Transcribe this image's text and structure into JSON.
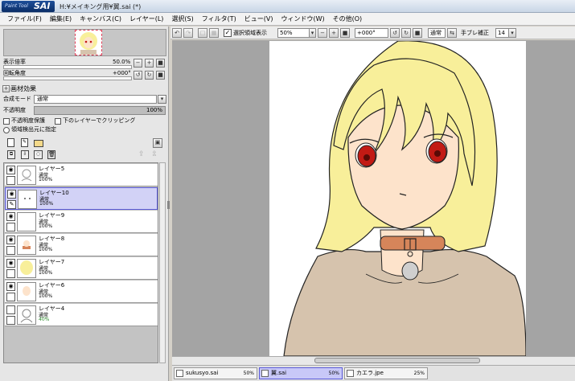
{
  "app": {
    "logo_small": "Paint Tool",
    "logo_big": "SAI",
    "window_title": "H:¥メイキング用¥翼.sai (*)"
  },
  "menus": [
    "ファイル(F)",
    "編集(E)",
    "キャンバス(C)",
    "レイヤー(L)",
    "選択(S)",
    "フィルタ(T)",
    "ビュー(V)",
    "ウィンドウ(W)",
    "その他(O)"
  ],
  "navigator": {
    "zoom_label": "表示倍率",
    "zoom_value": "50.0%",
    "rotate_label": "回転角度",
    "rotate_value": "+000°"
  },
  "layer_panel": {
    "effects_header": "画材効果",
    "blend_label": "合成モード",
    "blend_value": "通常",
    "opacity_label": "不透明度",
    "opacity_value": "100%",
    "preserve_opacity": "不透明度保護",
    "clipping": "下のレイヤーでクリッピング",
    "selection_source": "領域検出元に指定"
  },
  "layers": [
    {
      "name": "レイヤー5",
      "mode": "通常",
      "opacity": "100%",
      "visible": true,
      "selected": false
    },
    {
      "name": "レイヤー10",
      "mode": "通常",
      "opacity": "100%",
      "visible": true,
      "selected": true
    },
    {
      "name": "レイヤー9",
      "mode": "通常",
      "opacity": "100%",
      "visible": true,
      "selected": false
    },
    {
      "name": "レイヤー8",
      "mode": "通常",
      "opacity": "100%",
      "visible": true,
      "selected": false
    },
    {
      "name": "レイヤー7",
      "mode": "通常",
      "opacity": "100%",
      "visible": true,
      "selected": false
    },
    {
      "name": "レイヤー6",
      "mode": "通常",
      "opacity": "100%",
      "visible": true,
      "selected": false
    },
    {
      "name": "レイヤー4",
      "mode": "通常",
      "opacity": "40%",
      "visible": false,
      "selected": false
    }
  ],
  "toolbar": {
    "show_selection": "選択領域表示",
    "zoom": "50%",
    "rotation": "+000°",
    "mode": "通常",
    "stabilizer_label": "手ブレ補正",
    "stabilizer_value": "14"
  },
  "files": [
    {
      "name": "sukusyo.sai",
      "zoom": "50%",
      "active": false
    },
    {
      "name": "翼.sai",
      "zoom": "50%",
      "active": true
    },
    {
      "name": "カエラ.jpe",
      "zoom": "25%",
      "active": false
    }
  ],
  "colors": {
    "hair": "#f8ef9a",
    "skin": "#fde3cb",
    "eyes": "#c21a14",
    "collar": "#d6855a",
    "shirt": "#d6c3ad"
  }
}
